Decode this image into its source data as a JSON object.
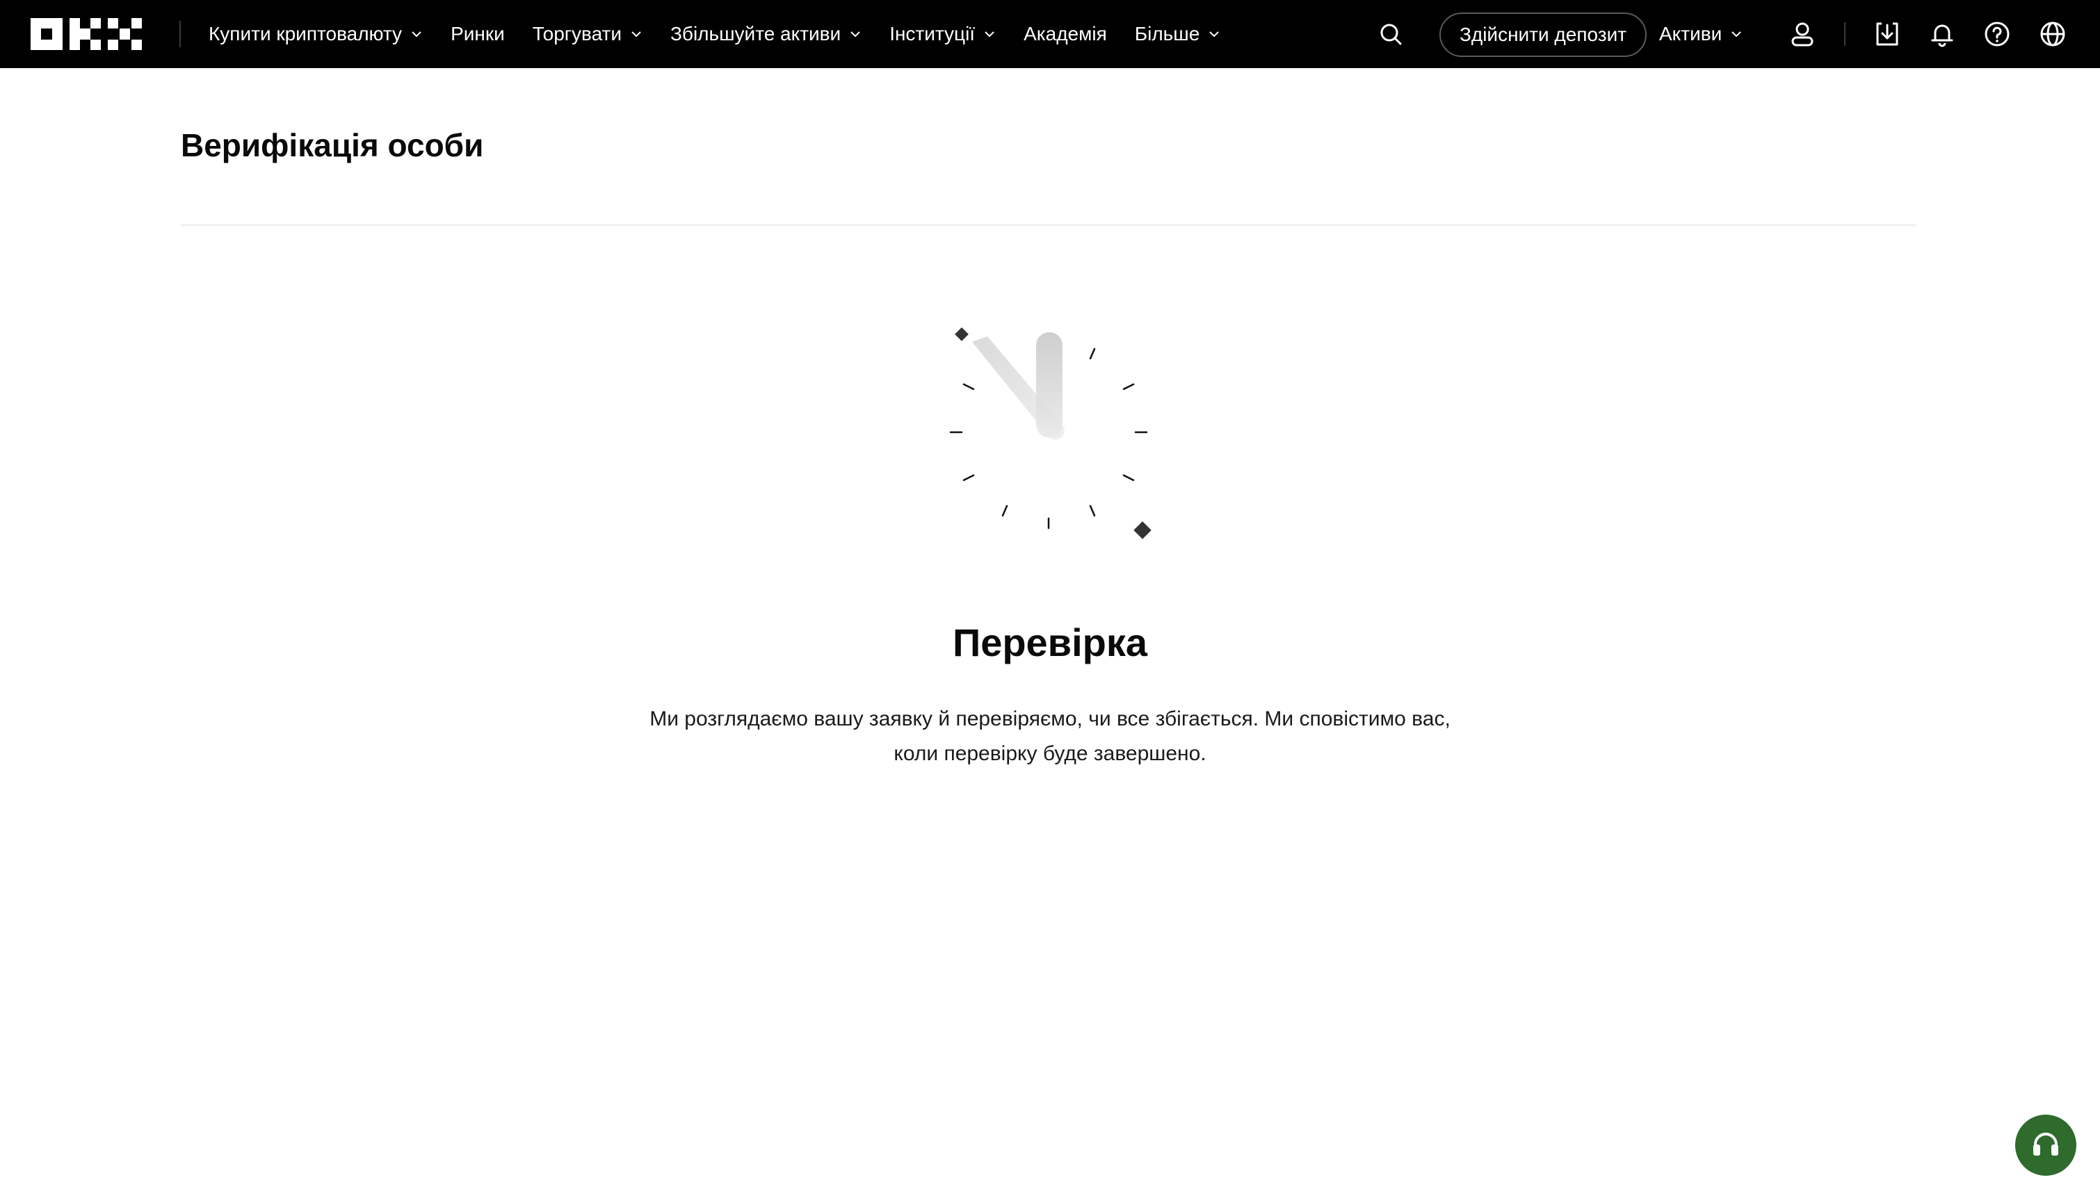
{
  "header": {
    "logo_icon": "okx-logo",
    "nav": [
      {
        "label": "Купити криптовалюту",
        "has_dropdown": true
      },
      {
        "label": "Ринки",
        "has_dropdown": false
      },
      {
        "label": "Торгувати",
        "has_dropdown": true
      },
      {
        "label": "Збільшуйте активи",
        "has_dropdown": true
      },
      {
        "label": "Інституції",
        "has_dropdown": true
      },
      {
        "label": "Академія",
        "has_dropdown": false
      },
      {
        "label": "Більше",
        "has_dropdown": true
      }
    ],
    "deposit_label": "Здійснити депозит",
    "assets_label": "Активи",
    "icons": [
      "search-icon",
      "user-icon",
      "download-icon",
      "bell-icon",
      "help-icon",
      "globe-icon"
    ]
  },
  "page": {
    "title": "Верифікація особи"
  },
  "status": {
    "title": "Перевірка",
    "description": "Ми розглядаємо вашу заявку й перевіряємо, чи все збігається. Ми сповістимо вас, коли перевірку буде завершено.",
    "illustration_icon": "hourglass-clock-icon"
  },
  "support": {
    "icon": "headset-icon"
  },
  "colors": {
    "header_bg": "#000000",
    "support_bg": "#2e6b2c",
    "rule": "#ececec"
  }
}
